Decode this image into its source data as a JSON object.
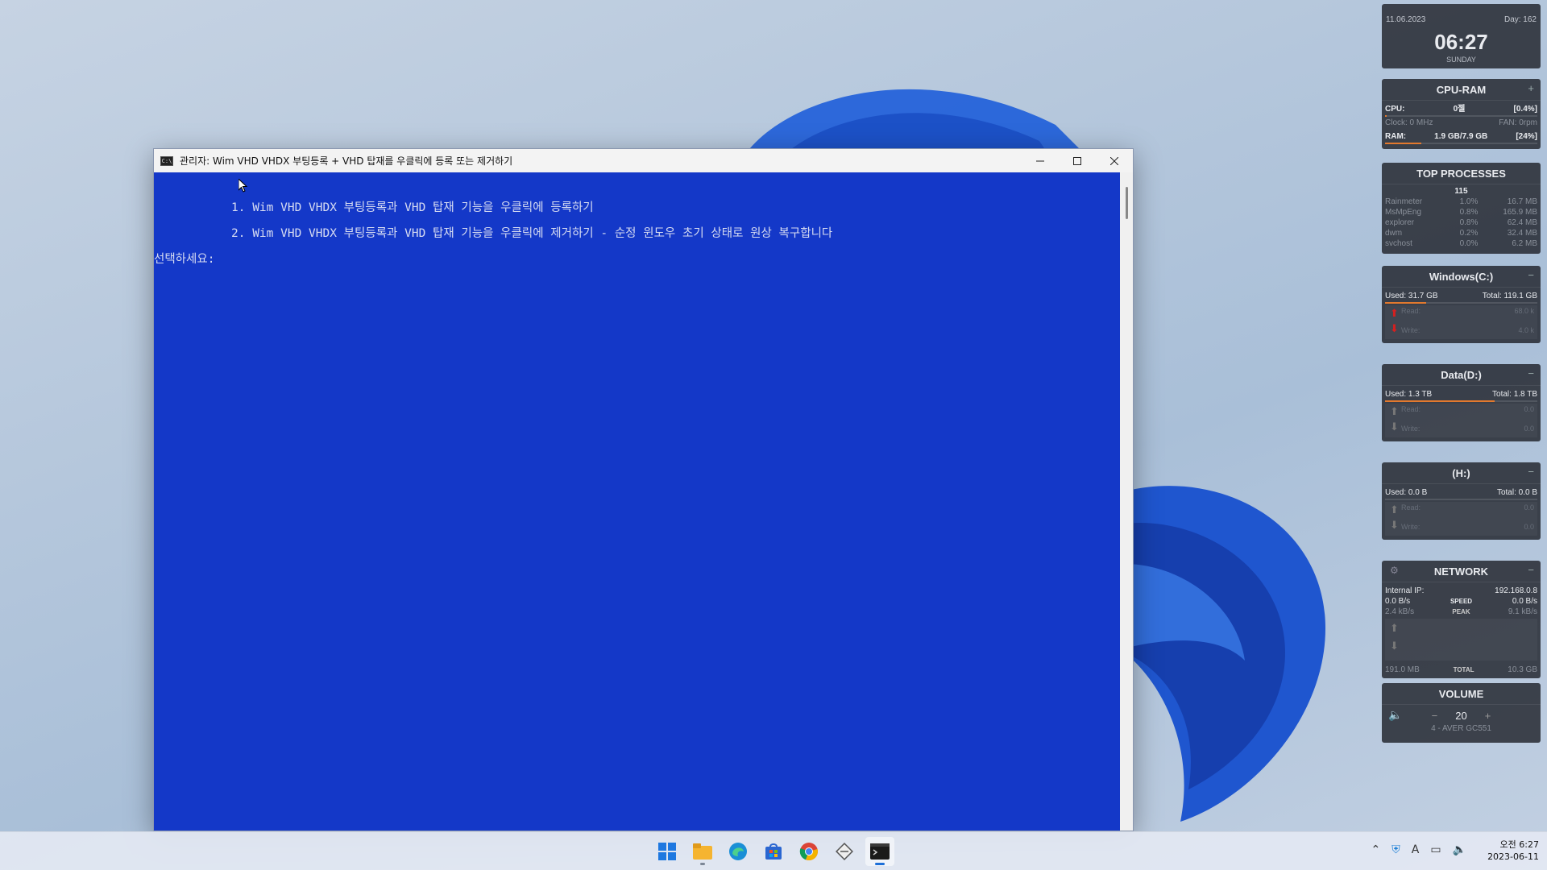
{
  "window": {
    "title": "관리자:  Wim VHD VHDX 부팅등록 + VHD 탑재를 우클릭에 등록 또는 제거하기",
    "icon": "cmd-icon",
    "bg_color": "#1438c8"
  },
  "console": {
    "line1": "1. Wim VHD VHDX 부팅등록과 VHD 탑재 기능을 우클릭에 등록하기",
    "line2": "2. Wim VHD VHDX 부팅등록과 VHD 탑재 기능을 우클릭에 제거하기 - 순정 윈도우 초기 상태로 원상 복구합니다",
    "prompt": "선택하세요:"
  },
  "widgets": {
    "clock": {
      "date": "11.06.2023",
      "day": "Day: 162",
      "time": "06:27",
      "weekday": "SUNDAY"
    },
    "cpu_ram": {
      "title": "CPU-RAM",
      "cpu_label": "CPU:",
      "cpu_value": "0젤",
      "cpu_pct": "[0.4%]",
      "clock_label": "Clock: 0 MHz",
      "fan_label": "FAN: 0rpm",
      "ram_label": "RAM:",
      "ram_value": "1.9 GB/7.9 GB",
      "ram_pct": "[24%]",
      "ram_fraction": 0.24
    },
    "top_processes": {
      "title": "TOP PROCESSES",
      "count": "115",
      "rows": [
        {
          "name": "Rainmeter",
          "cpu": "1.0%",
          "mem": "16.7 MB"
        },
        {
          "name": "MsMpEng",
          "cpu": "0.8%",
          "mem": "165.9 MB"
        },
        {
          "name": "explorer",
          "cpu": "0.8%",
          "mem": "62.4 MB"
        },
        {
          "name": "dwm",
          "cpu": "0.2%",
          "mem": "32.4 MB"
        },
        {
          "name": "svchost",
          "cpu": "0.0%",
          "mem": "6.2 MB"
        }
      ]
    },
    "drive_c": {
      "title": "Windows(C:)",
      "used": "Used: 31.7 GB",
      "total": "Total: 119.1 GB",
      "used_fraction": 0.27,
      "read_label": "Read:",
      "read_value": "68.0 k",
      "write_label": "Write:",
      "write_value": "4.0 k"
    },
    "drive_d": {
      "title": "Data(D:)",
      "used": "Used: 1.3 TB",
      "total": "Total: 1.8 TB",
      "used_fraction": 0.72,
      "read_label": "Read:",
      "read_value": "0.0",
      "write_label": "Write:",
      "write_value": "0.0"
    },
    "drive_h": {
      "title": "(H:)",
      "used": "Used: 0.0 B",
      "total": "Total: 0.0 B",
      "used_fraction": 0,
      "read_label": "Read:",
      "read_value": "0.0",
      "write_label": "Write:",
      "write_value": "0.0"
    },
    "network": {
      "title": "NETWORK",
      "ip_label": "Internal IP:",
      "ip_value": "192.168.0.8",
      "up_now": "0.0 B/s",
      "speed_label": "SPEED",
      "speed_value": "0.0 B/s",
      "down_now": "2.4 kB/s",
      "peak_label": "PEAK",
      "peak_value": "9.1 kB/s",
      "total_up": "191.0 MB",
      "total_label": "TOTAL",
      "total_value": "10.3 GB"
    },
    "volume": {
      "title": "VOLUME",
      "minus": "−",
      "level": "20",
      "plus": "+",
      "device": "4 - AVER GC551"
    }
  },
  "taskbar": {
    "apps": [
      "start-icon",
      "file-explorer-icon",
      "edge-icon",
      "store-icon",
      "chrome-icon",
      "tool-icon",
      "terminal-icon"
    ],
    "tray_clock_time": "오전 6:27",
    "tray_clock_date": "2023-06-11",
    "accent": "#1d6fd8"
  }
}
